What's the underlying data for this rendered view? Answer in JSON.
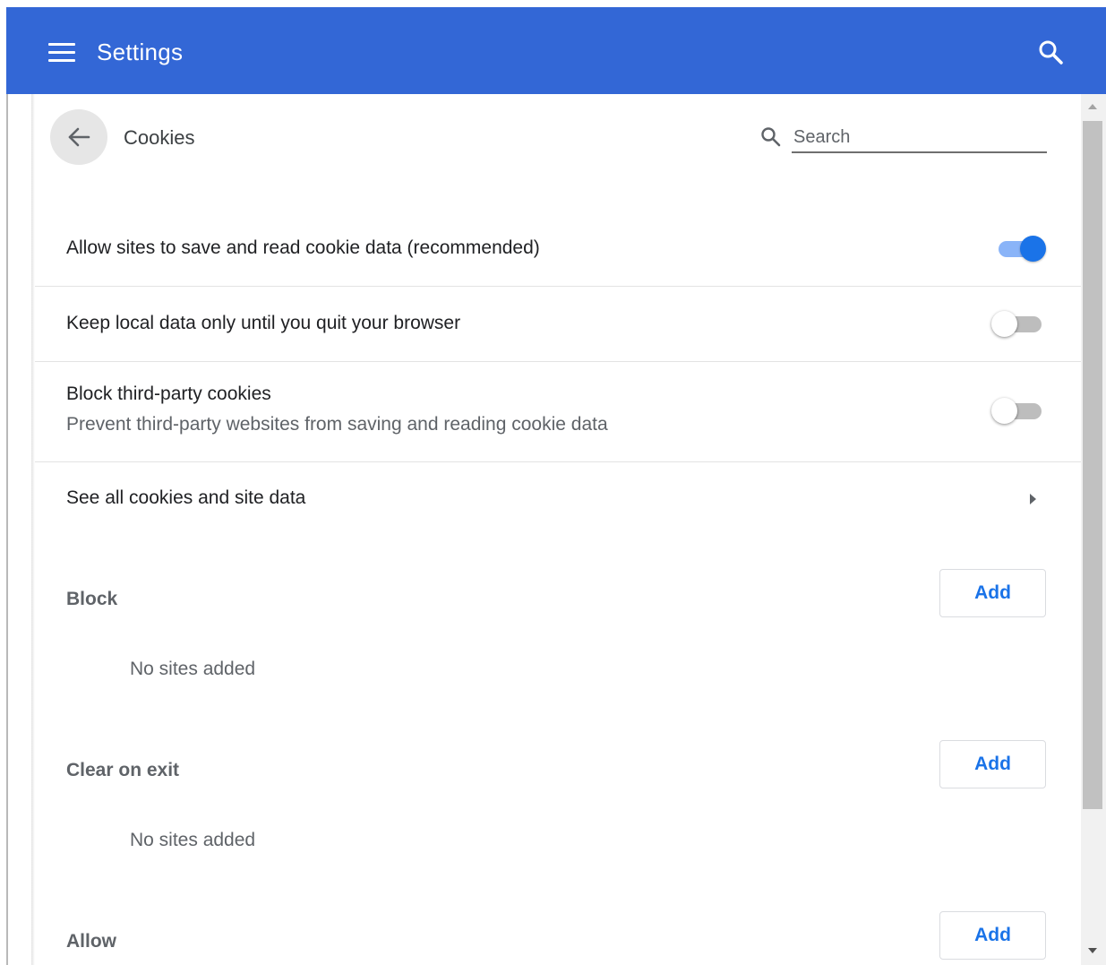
{
  "header": {
    "title": "Settings",
    "color": "#3367d6"
  },
  "page": {
    "title": "Cookies",
    "search_placeholder": "Search"
  },
  "settings": [
    {
      "label": "Allow sites to save and read cookie data (recommended)",
      "enabled": true
    },
    {
      "label": "Keep local data only until you quit your browser",
      "enabled": false
    },
    {
      "label": "Block third-party cookies",
      "description": "Prevent third-party websites from saving and reading cookie data",
      "enabled": false
    }
  ],
  "link_row": {
    "label": "See all cookies and site data"
  },
  "sections": [
    {
      "title": "Block",
      "add_label": "Add",
      "empty_text": "No sites added"
    },
    {
      "title": "Clear on exit",
      "add_label": "Add",
      "empty_text": "No sites added"
    },
    {
      "title": "Allow",
      "add_label": "Add"
    }
  ],
  "icons": [
    "hamburger-menu-icon",
    "search-icon",
    "arrow-back-icon",
    "search-icon",
    "chevron-right-icon",
    "scroll-up-arrow-icon",
    "scroll-down-arrow-icon"
  ]
}
